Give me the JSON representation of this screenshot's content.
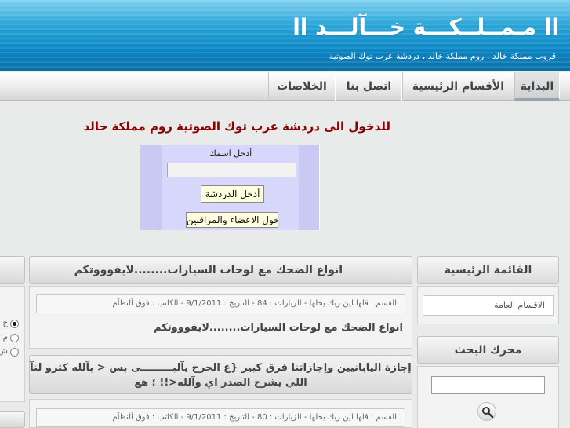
{
  "header": {
    "title": "اا مـمــلــكـــة خـــآلـــد اا",
    "subtitle": "قروب مملكة خالد ، روم مملكة خالد ، دردشة عرب توك الصوتية"
  },
  "nav": {
    "items": [
      "البداية",
      "الأقسام الرئيسية",
      "اتصل بنا",
      "الخلاصات"
    ],
    "active": "البداية"
  },
  "chat": {
    "link_text": "للدخول الى دردشة عرب توك الصوتية   روم    مملكة خالد",
    "name_label": "أدخل اسمك",
    "name_value": "",
    "enter_button": "أدخل الدردشة",
    "members_button": "دخول الاعضاء والمراقبين"
  },
  "sidebar": {
    "main_menu_title": "القائمة الرئيسية",
    "main_menu_items": [
      "الاقسام العامة"
    ],
    "search_title": "محرك البحث",
    "search_value": ""
  },
  "posts": [
    {
      "title": "انواع الضحك مع لوحات السيارات........لايفوووتكم",
      "meta": "القسم : قلها لين ربك يحلها - الزيارات : 84 - التاريخ : 9/1/2011 - الكاتب : فوق آلنظآم",
      "text": "انواع الضحك مع لوحات السيارات........لايفوووتكم"
    },
    {
      "title": "إجازة اليابانيين وإجازاتنا فرق كبير {ع الجرح يآلبـــــــــى بس < بآلله كثرو لنآ اللي يشرح الصدر اي وآلله<!! ؛ هع",
      "meta": "القسم : قلها لين ربك يحلها - الزيارات : 80 - التاريخ : 9/1/2011 - الكاتب : فوق آلنظآم"
    }
  ],
  "left_column": {
    "options": [
      "خ",
      "م",
      "ش"
    ],
    "selected_index": 0
  }
}
